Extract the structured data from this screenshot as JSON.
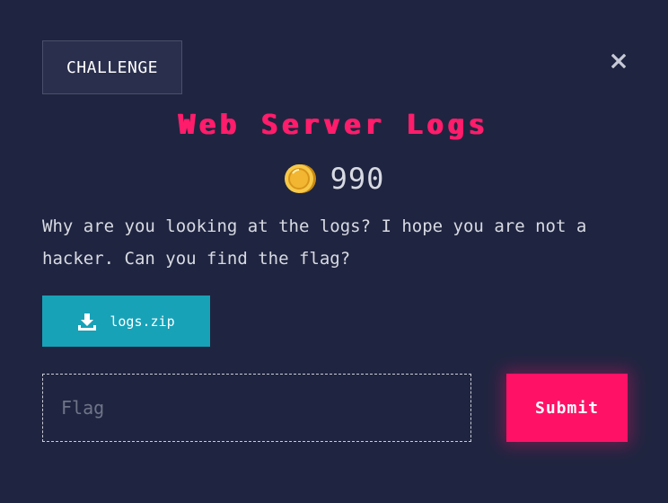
{
  "tab": {
    "label": "CHALLENGE"
  },
  "close": {
    "icon": "close-icon"
  },
  "challenge": {
    "title": "Web Server Logs",
    "points": "990",
    "coin_icon": "coin-icon",
    "description": "Why are you looking at the logs? I hope you are not a hacker. Can you find the flag?"
  },
  "download": {
    "label": "logs.zip",
    "icon": "download-icon"
  },
  "flag_input": {
    "value": "",
    "placeholder": "Flag"
  },
  "submit": {
    "label": "Submit"
  },
  "colors": {
    "background": "#1f2540",
    "accent_pink": "#ff1266",
    "download_teal": "#17a2b8",
    "coin_gold": "#f7c948"
  }
}
